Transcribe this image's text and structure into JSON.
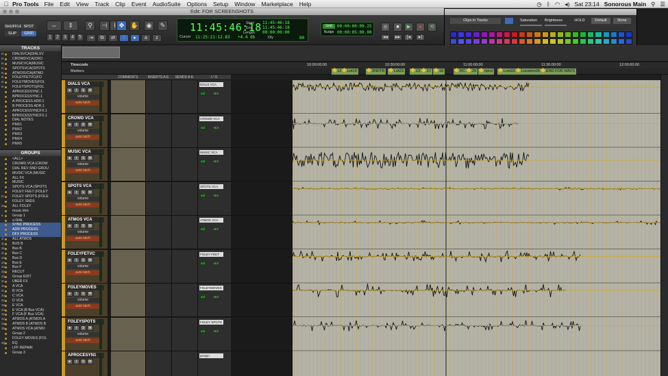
{
  "menubar": {
    "app_name": "Pro Tools",
    "menus": [
      "File",
      "Edit",
      "View",
      "Track",
      "Clip",
      "Event",
      "AudioSuite",
      "Options",
      "Setup",
      "Window",
      "Marketplace",
      "Help"
    ],
    "clock": "Sat 23:14",
    "user": "Sonorous Main"
  },
  "window": {
    "title": "Edit: FOR SCREENSHOTS"
  },
  "toolbar": {
    "modes": {
      "shuffle": "SHUFFLE",
      "spot": "SPOT",
      "slip": "SLIP",
      "grid": "GRID"
    },
    "main_counter": "11:45:46:18",
    "cursor_label": "Cursor",
    "cursor_value": "11:25:21:12.83",
    "level": "+4.4 db",
    "start_label": "Start",
    "end_label": "End",
    "length_label": "Length",
    "start_value": "11:45:46:18",
    "end_value": "11:45:46:18",
    "length_value": "00:00:00:00",
    "dly_label": "Dly",
    "grid_label": "Grid",
    "grid_value": "00:00:00:00.25",
    "nudge_label": "Nudge",
    "nudge_value": "00:00:05:00.00",
    "zoom_value": "80"
  },
  "palette": {
    "target": "Clips in Tracks",
    "saturation": "Saturation",
    "brightness": "Brightness",
    "hold": "HOLD",
    "default": "Default",
    "none": "None",
    "rows": [
      [
        "#2a2ad0",
        "#3a3ae8",
        "#4a28d0",
        "#6a1ec8",
        "#8a1ab8",
        "#a81a9a",
        "#c0187a",
        "#c81a4a",
        "#c81a22",
        "#c83a18",
        "#c85818",
        "#c87818",
        "#c8981a",
        "#b8b01a",
        "#98b81a",
        "#6ab81a",
        "#3ab81a",
        "#1ab83a",
        "#1ab86a",
        "#1ab898",
        "#1a98b8",
        "#1a78c8",
        "#1a58c8",
        "#1a3ac8"
      ],
      [
        "#3a4ae0",
        "#4a5af0",
        "#5a48e0",
        "#7a3ed8",
        "#9a3ac8",
        "#b83aaa",
        "#d0388a",
        "#d83a5a",
        "#d83a32",
        "#d85a28",
        "#d87828",
        "#d89828",
        "#d8b82a",
        "#c8c82a",
        "#a8c82a",
        "#7ac82a",
        "#4ac82a",
        "#2ac84a",
        "#2ac87a",
        "#2ac8a8",
        "#2aa8c8",
        "#2a88d8",
        "#2a68d8",
        "#2a4ad8"
      ],
      [
        "#2222a0",
        "#3232b8",
        "#3a2098",
        "#521890",
        "#6a1488",
        "#80146e",
        "#90125a",
        "#981438",
        "#98141a",
        "#983014",
        "#984414",
        "#985c14",
        "#987414",
        "#888414",
        "#708c14",
        "#508c14",
        "#2c8c14",
        "#148c2c",
        "#148c50",
        "#148c74",
        "#14748c",
        "#145c98",
        "#144498",
        "#142c98"
      ]
    ]
  },
  "tracks_panel": {
    "title": "TRACKS",
    "items": [
      {
        "key": "N",
        "label": "DIALSVCA(DIALSV"
      },
      {
        "key": "N",
        "label": "CROWDVCA(CRO"
      },
      {
        "key": "N",
        "label": "MUSICVCA(MUSIC"
      },
      {
        "key": "N",
        "label": "SPOTSVCA(SPOTS"
      },
      {
        "key": "N",
        "label": "ATMOSVCA(ATMO"
      },
      {
        "key": "N",
        "label": "FOLEYFETVC(FO"
      },
      {
        "key": "N",
        "label": "FOLEYMOVES(FOL"
      },
      {
        "key": "N",
        "label": "FOLEYSPOTS(FOL"
      },
      {
        "key": "",
        "label": "APROCESSYNC.1"
      },
      {
        "key": "",
        "label": "BPROCESSYNC.1"
      },
      {
        "key": "",
        "label": "A PROCESS ADR.1"
      },
      {
        "key": "",
        "label": "B PROCESS ADR.1"
      },
      {
        "key": "",
        "label": "APROCESSYNCFX.1"
      },
      {
        "key": "",
        "label": "BPROCESSYNCFX.1"
      },
      {
        "key": "",
        "label": "DIAL NOTES"
      },
      {
        "key": "",
        "label": "PMX1"
      },
      {
        "key": "",
        "label": "PMX2"
      },
      {
        "key": "",
        "label": "PMX3"
      },
      {
        "key": "",
        "label": "PMX4"
      },
      {
        "key": "",
        "label": "PMX5"
      }
    ]
  },
  "groups_panel": {
    "title": "GROUPS",
    "items": [
      {
        "key": "",
        "label": "<ALL>"
      },
      {
        "key": "",
        "label": "CROWD VCA (CROW"
      },
      {
        "key": "",
        "label": "DIAL REV SND GROU"
      },
      {
        "key": "",
        "label": "MUSIC VCA (MUSIC"
      },
      {
        "key": "",
        "label": "ALL FX"
      },
      {
        "key": "",
        "label": "MUSIC"
      },
      {
        "key": "",
        "label": "SPOTS VCA (SPOTS"
      },
      {
        "key": "",
        "label": "FOLEY FEET (FOLEY"
      },
      {
        "key": "m",
        "label": "FOLEY SPOTS (FOLE"
      },
      {
        "key": "",
        "label": "FOLEY SNDS"
      },
      {
        "key": "2a",
        "label": "ALL FOLEY"
      },
      {
        "key": "",
        "label": "music trim"
      },
      {
        "key": "a",
        "label": "Group 1"
      },
      {
        "key": "",
        "label": "a DIAL"
      },
      {
        "key": "",
        "label": "SYNC PROCESS"
      },
      {
        "key": "",
        "label": "ADR PROCESS"
      },
      {
        "key": "",
        "label": "DFX PROCESS"
      },
      {
        "key": "2i",
        "label": "ALL ATMOS"
      },
      {
        "key": "2j",
        "label": "BUS B"
      },
      {
        "key": "2k",
        "label": "Bus B"
      },
      {
        "key": "2l",
        "label": "Bus C"
      },
      {
        "key": "2m",
        "label": "Bus D"
      },
      {
        "key": "2n",
        "label": "Bus E"
      },
      {
        "key": "2o",
        "label": "Bus F"
      },
      {
        "key": "2p",
        "label": "RECUT"
      },
      {
        "key": "2q",
        "label": "Group EDIT"
      },
      {
        "key": "2r",
        "label": "UBER FX"
      },
      {
        "key": "2s",
        "label": "A VCA"
      },
      {
        "key": "2t",
        "label": "B VCA"
      },
      {
        "key": "2u",
        "label": "C VCA"
      },
      {
        "key": "2v",
        "label": "D VCA"
      },
      {
        "key": "2w",
        "label": "E VCA"
      },
      {
        "key": "2x",
        "label": "E VCA (B Bus VCA)"
      },
      {
        "key": "2y",
        "label": "F VCA (F Bus VCA)"
      },
      {
        "key": "2z",
        "label": "ATMOS A (ATMOS A"
      },
      {
        "key": "3a",
        "label": "ATMOS B (ATMOS B"
      },
      {
        "key": "3b",
        "label": "ATMOS VCA (ATMO"
      },
      {
        "key": "",
        "label": "Group 2"
      },
      {
        "key": "",
        "label": "FOLEY MOVES (FOL"
      },
      {
        "key": "3g",
        "label": "EQ"
      },
      {
        "key": "",
        "label": "LFF REPAIR"
      },
      {
        "key": "",
        "label": "Group 3"
      }
    ]
  },
  "rulers": {
    "timecode_label": "Timecode",
    "markers_label": "Markers",
    "timecodes": [
      "10:00:00:00",
      "10:30:00:00",
      "11:00:00:00",
      "11:30:00:00",
      "12:00:00:00"
    ],
    "markers": [
      "L8",
      "Lot10",
      "2NDTR",
      "Lot23",
      "13",
      "17",
      "18",
      "RC",
      "29",
      "rplcd",
      "Lcto33",
      "Location35",
      "END FOR WAVS"
    ]
  },
  "columns": {
    "comments": "COMMENTS",
    "inserts": "INSERTS A-E",
    "sends": "SENDS A-E",
    "io": "I / O"
  },
  "track_list": [
    {
      "name": "DIALS VCA",
      "output": "DIALS VCA",
      "view": "volume",
      "auto": "auto latch",
      "vol": "vol",
      "vol_value": "-8.0"
    },
    {
      "name": "CROWD VCA",
      "output": "CROWD VCA",
      "view": "volume",
      "auto": "auto latch",
      "vol": "vol",
      "vol_value": "-8.0"
    },
    {
      "name": "MUSIC VCA",
      "output": "MUSIC VCA",
      "view": "volume",
      "auto": "auto latch",
      "vol": "vol",
      "vol_value": "-8.0"
    },
    {
      "name": "SPOTS VCA",
      "output": "SPOTS VCA",
      "view": "volume",
      "auto": "auto latch",
      "vol": "vol",
      "vol_value": "-8.0"
    },
    {
      "name": "ATMOS VCA",
      "output": "ATMOS VCA",
      "view": "volume",
      "auto": "auto latch",
      "vol": "vol",
      "vol_value": "-8.0"
    },
    {
      "name": "FOLEYFETVC",
      "output": "FOLEY FEET",
      "view": "volume",
      "auto": "auto latch",
      "vol": "vol",
      "vol_value": "-8.0"
    },
    {
      "name": "FOLEYMOVES",
      "output": "FOLEYMOVES",
      "view": "volume",
      "auto": "auto latch",
      "vol": "vol",
      "vol_value": "-8.0"
    },
    {
      "name": "FOLEYSPOTS",
      "output": "FOLEY SPOTS",
      "view": "volume",
      "auto": "auto latch",
      "vol": "vol",
      "vol_value": "-8.0"
    },
    {
      "name": "APROCESYN1",
      "output": "prosyn",
      "view": "",
      "auto": "",
      "vol": "",
      "vol_value": ""
    }
  ],
  "button_labels": {
    "rec": "●",
    "input": "I",
    "solo": "S",
    "mute": "M"
  }
}
